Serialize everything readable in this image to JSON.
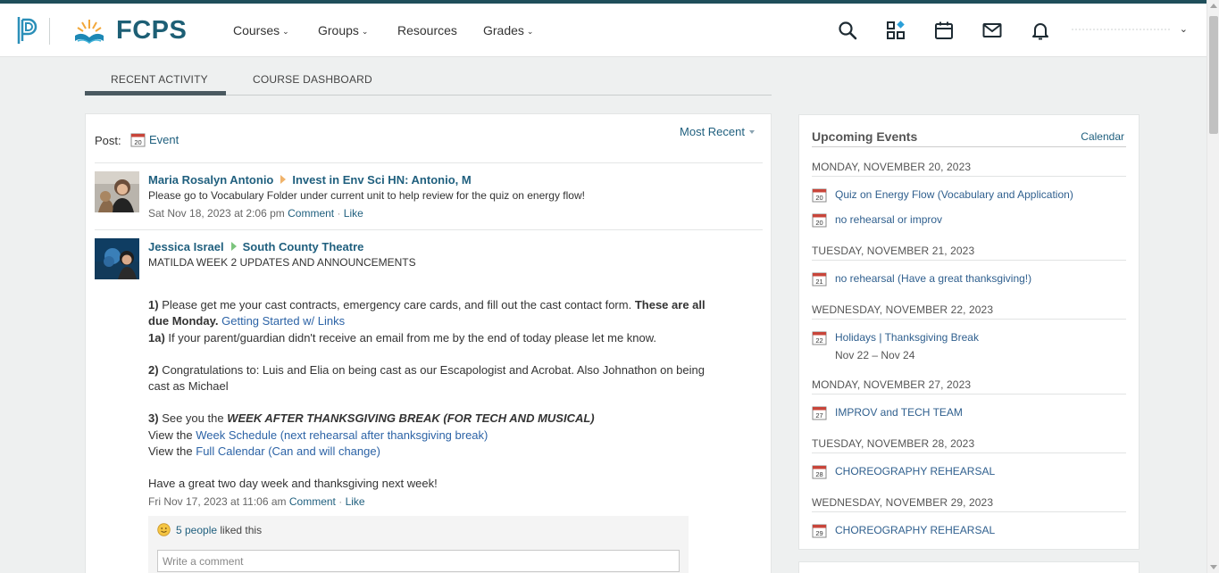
{
  "header": {
    "district_name": "FCPS",
    "nav": [
      {
        "label": "Courses",
        "has_menu": true
      },
      {
        "label": "Groups",
        "has_menu": true
      },
      {
        "label": "Resources",
        "has_menu": false
      },
      {
        "label": "Grades",
        "has_menu": true
      }
    ],
    "icons": [
      "search-icon",
      "apps-icon",
      "calendar-icon",
      "mail-icon",
      "bell-icon"
    ],
    "accent_color": "#1d5f75"
  },
  "tabs": [
    {
      "label": "RECENT ACTIVITY",
      "active": true
    },
    {
      "label": "COURSE DASHBOARD",
      "active": false
    }
  ],
  "feed": {
    "post_label": "Post:",
    "post_event_label": "Event",
    "post_event_icon_day": "20",
    "sort_label": "Most Recent",
    "entries": [
      {
        "author": "Maria Rosalyn Antonio",
        "target": "Invest in Env Sci HN: Antonio, M",
        "text": "Please go to Vocabulary Folder under current unit to help review for the quiz on energy flow!",
        "timestamp": "Sat Nov 18, 2023 at 2:06 pm",
        "comment_label": "Comment",
        "like_label": "Like"
      },
      {
        "author": "Jessica Israel",
        "target": "South County Theatre",
        "text": "MATILDA WEEK 2 UPDATES AND ANNOUNCEMENTS",
        "body": {
          "p1_num": "1)",
          "p1_text": "Please get me your cast contracts, emergency care cards, and fill out the cast contact form.",
          "p1_bold_a": "These are all",
          "p1_bold_b": "due Monday.",
          "p1_link": "Getting Started w/ Links",
          "p1a_num": "1a)",
          "p1a_text": "If your parent/guardian didn't receive an email from me by the end of today please let me know.",
          "p2_num": "2)",
          "p2_text_a": "Congratulations to: Luis and Elia on being cast as our Escapologist and Acrobat. Also Johnathon on being",
          "p2_text_b": "cast as Michael",
          "p3_num": "3)",
          "p3_text": "See you the",
          "p3_emph": "WEEK AFTER THANKSGIVING BREAK (FOR TECH AND MUSICAL)",
          "view_label": "View the",
          "link_week": "Week Schedule (next rehearsal after thanksgiving break)",
          "link_cal": "Full Calendar (Can and will change)",
          "closing": "Have a great two day week and thanksgiving next week!"
        },
        "timestamp": "Fri Nov 17, 2023 at 11:06 am",
        "comment_label": "Comment",
        "like_label": "Like",
        "likes_link": "5 people",
        "likes_suffix": "liked this",
        "comment_placeholder": "Write a comment"
      }
    ]
  },
  "events_panel": {
    "title": "Upcoming Events",
    "calendar_link": "Calendar",
    "days": [
      {
        "header": "Monday, November 20, 2023",
        "events": [
          {
            "day": "20",
            "title": "Quiz on Energy Flow (Vocabulary and Application)"
          },
          {
            "day": "20",
            "title": "no rehearsal or improv"
          }
        ]
      },
      {
        "header": "Tuesday, November 21, 2023",
        "events": [
          {
            "day": "21",
            "title": "no rehearsal (Have a great thanksgiving!)"
          }
        ]
      },
      {
        "header": "Wednesday, November 22, 2023",
        "events": [
          {
            "day": "22",
            "title": "Holidays | Thanksgiving Break",
            "sub": "Nov 22 – Nov 24"
          }
        ]
      },
      {
        "header": "Monday, November 27, 2023",
        "events": [
          {
            "day": "27",
            "title": "IMPROV and TECH TEAM"
          }
        ]
      },
      {
        "header": "Tuesday, November 28, 2023",
        "events": [
          {
            "day": "28",
            "title": "CHOREOGRAPHY REHEARSAL"
          }
        ]
      },
      {
        "header": "Wednesday, November 29, 2023",
        "events": [
          {
            "day": "29",
            "title": "CHOREOGRAPHY REHEARSAL"
          }
        ]
      }
    ]
  }
}
